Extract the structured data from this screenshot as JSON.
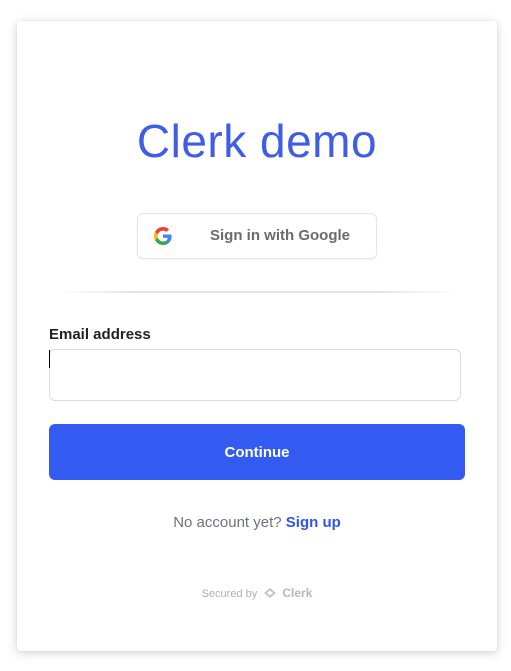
{
  "card": {
    "title": "Clerk demo",
    "google_button_label": "Sign in with Google",
    "email_label": "Email address",
    "email_value": "",
    "continue_label": "Continue",
    "no_account_text": "No account yet?",
    "sign_up_link": "Sign up",
    "secured_by_text": "Secured by",
    "secured_brand": "Clerk"
  },
  "colors": {
    "title": "#3f5de6",
    "primary_button": "#335bf1",
    "link": "#2f54eb"
  },
  "icons": {
    "google": "google-g-logo",
    "clerk": "clerk-logo"
  }
}
